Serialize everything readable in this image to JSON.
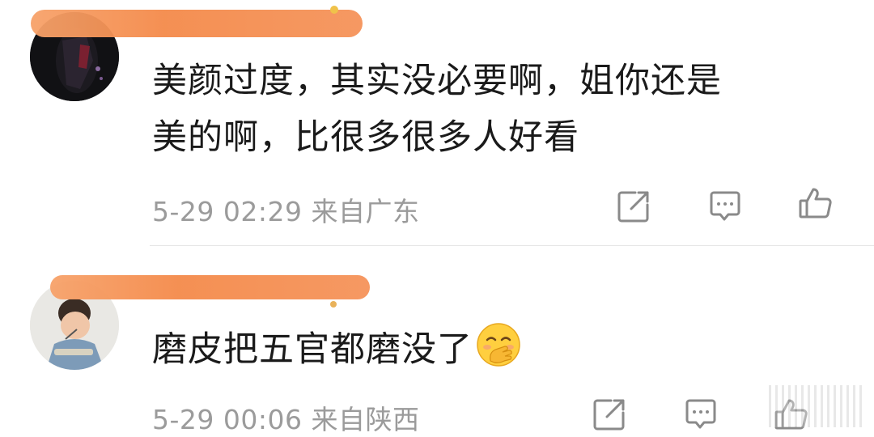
{
  "comments": [
    {
      "text_line1": "美颜过度，其实没必要啊，姐你还是",
      "text_line2": "美的啊，比很多很多人好看",
      "time": "5-29 02:29",
      "location": "来自广东"
    },
    {
      "text": "磨皮把五官都磨没了",
      "emoji": "hand-over-mouth-emoji",
      "time": "5-29 00:06",
      "location": "来自陕西"
    }
  ],
  "icons": {
    "share": "share-icon",
    "reply": "comment-icon",
    "like": "thumbs-up-icon"
  },
  "colors": {
    "text": "#1a1a1a",
    "meta": "#9b9b9b",
    "redaction": "#f48a4a"
  }
}
